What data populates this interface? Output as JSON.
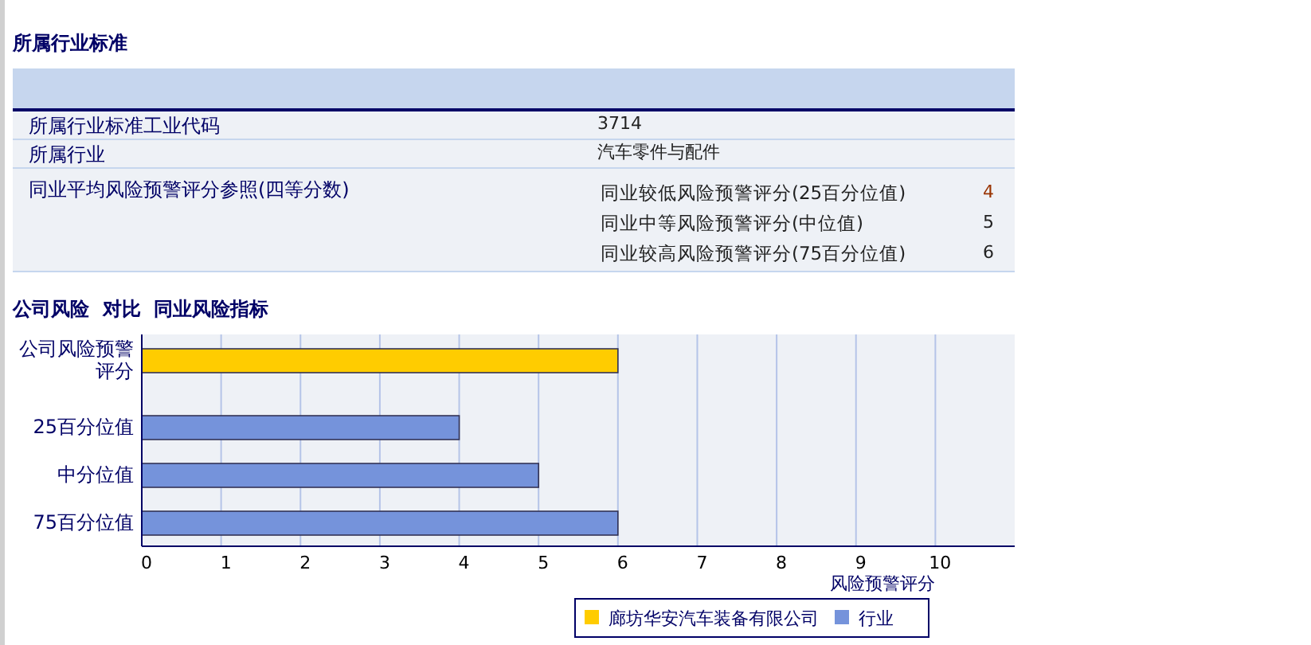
{
  "section_title": "所属行业标准",
  "rows": [
    {
      "label": "所属行业标准工业代码",
      "value": "3714"
    },
    {
      "label": "所属行业",
      "value": "汽车零件与配件"
    }
  ],
  "reference": {
    "label": "同业平均风险预警评分参照(四等分数)",
    "items": [
      {
        "name": "同业较低风险预警评分(25百分位值)",
        "score": "4"
      },
      {
        "name": "同业中等风险预警评分(中位值)",
        "score": "5"
      },
      {
        "name": "同业较高风险预警评分(75百分位值)",
        "score": "6"
      }
    ]
  },
  "chart_title": "公司风险  对比  同业风险指标",
  "chart_data": {
    "type": "bar",
    "orientation": "horizontal",
    "stacked": true,
    "xlabel": "风险预警评分",
    "categories": [
      "公司风险预警评分",
      "25百分位值",
      "中分位值",
      "75百分位值"
    ],
    "series": [
      {
        "name": "廊坊华安汽车装备有限公司",
        "color": "#ffcc00",
        "values": [
          6,
          null,
          null,
          null
        ]
      },
      {
        "name": "行业",
        "color": "#7593db",
        "values": [
          null,
          4,
          5,
          6
        ]
      }
    ],
    "grid": true,
    "legend": true,
    "xlim": [
      0,
      11
    ],
    "xticks": [
      {
        "value": 0,
        "label": "0"
      },
      {
        "value": 1,
        "label": "1"
      },
      {
        "value": 2,
        "label": "2"
      },
      {
        "value": 3,
        "label": "3"
      },
      {
        "value": 4,
        "label": "4"
      },
      {
        "value": 5,
        "label": "5"
      },
      {
        "value": 6,
        "label": "6"
      },
      {
        "value": 7,
        "label": "7"
      },
      {
        "value": 8,
        "label": "8"
      },
      {
        "value": 9,
        "label": "9"
      },
      {
        "value": 10,
        "label": "10"
      }
    ]
  }
}
